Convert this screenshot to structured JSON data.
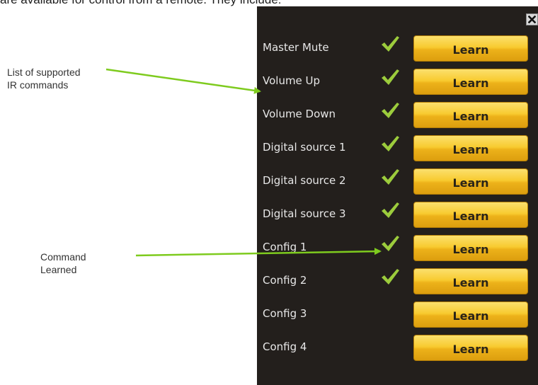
{
  "intro_text": "are available for control from a remote. They include:",
  "annotations": {
    "ir_list": {
      "line1": "List of supported",
      "line2": "IR commands"
    },
    "learned": {
      "line1": "Command",
      "line2": "Learned"
    }
  },
  "dialog": {
    "close_icon": "close-icon",
    "learn_label": "Learn",
    "commands": [
      {
        "label": "Master Mute",
        "learned": true
      },
      {
        "label": "Volume Up",
        "learned": true
      },
      {
        "label": "Volume Down",
        "learned": true
      },
      {
        "label": "Digital source 1",
        "learned": true
      },
      {
        "label": "Digital source 2",
        "learned": true
      },
      {
        "label": "Digital source 3",
        "learned": true
      },
      {
        "label": "Config 1",
        "learned": true
      },
      {
        "label": "Config 2",
        "learned": true
      },
      {
        "label": "Config 3",
        "learned": false
      },
      {
        "label": "Config 4",
        "learned": false
      }
    ]
  },
  "colors": {
    "panel_bg": "#231f1c",
    "arrow": "#7ecb1e",
    "check": "#9ccc3c",
    "button": "#f8cb30"
  }
}
